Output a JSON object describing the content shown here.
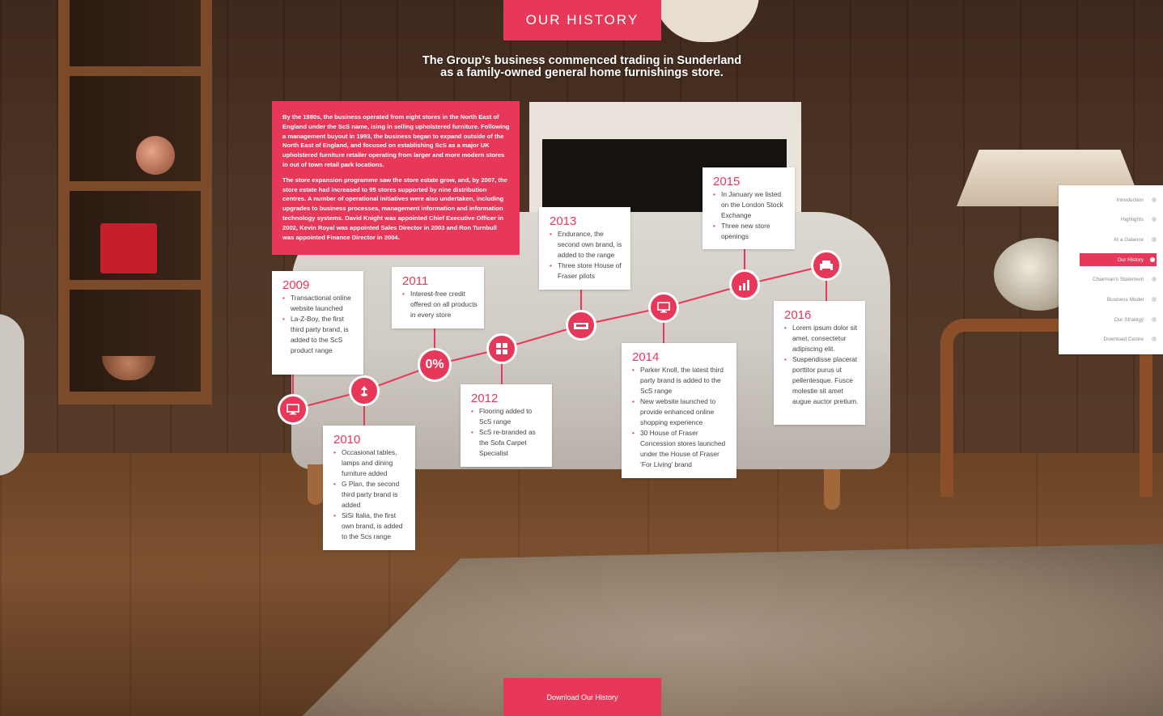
{
  "header": {
    "title": "OUR HISTORY"
  },
  "intro": {
    "line1": "The Group’s business commenced trading in Sunderland",
    "line2": "as a family-owned general home furnishings store."
  },
  "intro_box": {
    "p1": "By the 1980s, the business operated from eight stores in the North East of England under the ScS name, ising in selling upholstered furniture. Following a management buyout in 1993, the business began to expand outside of the North East of England, and focused on establishing ScS as a major UK upholstered furniture retailer operating from larger and more modern stores in out of town retail park locations.",
    "p2": "The store expansion programme saw the store estate grow, and, by 2007, the store estate had increased to 95 stores supported by nine distribution centres. A number of operational initiatives were also undertaken, including upgrades to business processes, management information and information technology systems. David Knight was appointed Chief Executive Officer in 2002, Kevin Royal was appointed Sales Director in 2003 and Ron Turnbull was appointed Finance Director in 2004."
  },
  "timeline": {
    "y2009": {
      "year": "2009",
      "items": [
        "Transactional online website launched",
        "La-Z-Boy, the first third party brand, is added to the ScS product range"
      ]
    },
    "y2010": {
      "year": "2010",
      "items": [
        "Occasional tables, lamps and dining furniture added",
        "G Plan, the second third party brand is added",
        "SiSi Italia, the first own brand, is added to the Scs range"
      ]
    },
    "y2011": {
      "year": "2011",
      "items": [
        "Interest-free credit offered on all products in every store"
      ],
      "icon_text": "0%"
    },
    "y2012": {
      "year": "2012",
      "items": [
        "Flooring added to ScS range",
        "ScS re-branded as the Sofa Carpet Specialist"
      ]
    },
    "y2013": {
      "year": "2013",
      "items": [
        "Endurance, the second own brand, is added to the range",
        "Three store House of Fraser pilots"
      ]
    },
    "y2014": {
      "year": "2014",
      "items": [
        "Parker Knoll, the latest third party brand is added to the ScS range",
        "New website launched to provide enhanced online shopping experience",
        "30 House of Fraser Concession stores launched under the House of Fraser ‘For Living’ brand"
      ]
    },
    "y2015": {
      "year": "2015",
      "items": [
        "In January we listed on the London Stock Exchange",
        "Three new store openings"
      ]
    },
    "y2016": {
      "year": "2016",
      "items": [
        "Lorem ipsum dolor sit amet, consectetur adipiscing elit.",
        "Suspendisse placerat porttitor purus ut pellentesque. Fusce molestie sit amet augue auctor pretium."
      ]
    }
  },
  "side_nav": {
    "items": [
      {
        "label": "Introduction"
      },
      {
        "label": "Highlights"
      },
      {
        "label": "At a Galance"
      },
      {
        "label": "Our History"
      },
      {
        "label": "Chairman's Statement"
      },
      {
        "label": "Business Model"
      },
      {
        "label": "Our Strategy"
      },
      {
        "label": "Download Centre"
      }
    ],
    "active": "Our History"
  },
  "download": {
    "label": "Download Our History"
  },
  "colors": {
    "accent": "#e8385a",
    "card": "#ffffff"
  }
}
